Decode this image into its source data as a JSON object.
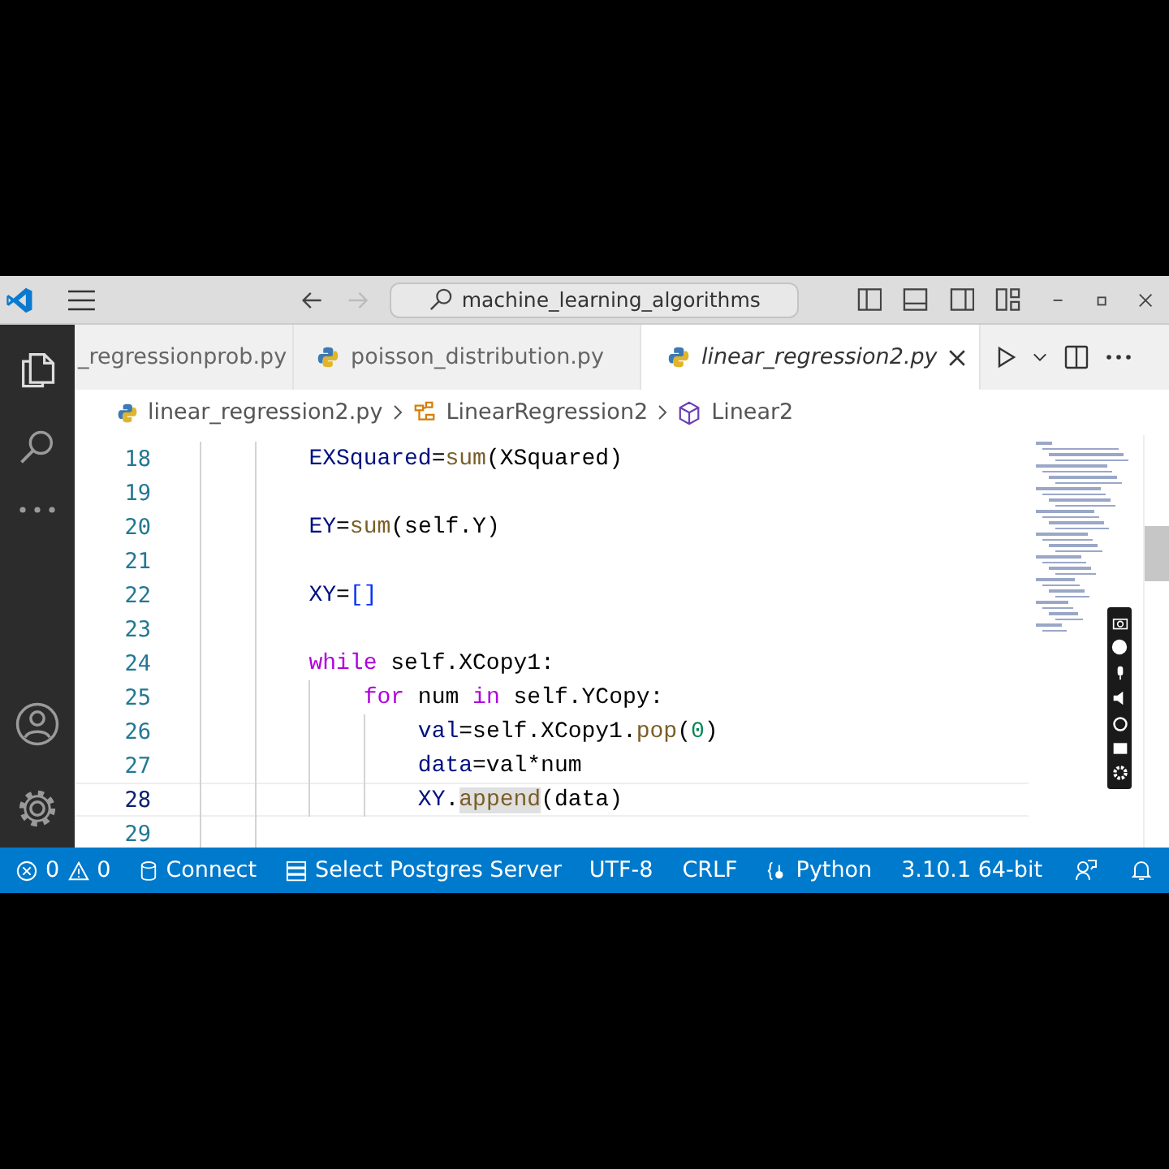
{
  "title_bar": {
    "search": {
      "value": "machine_learning_algorithms"
    },
    "forward_disabled": true
  },
  "activity_bar": {
    "items": [
      {
        "kind": "files",
        "selected": true
      },
      {
        "kind": "search",
        "selected": false
      },
      {
        "kind": "more",
        "selected": false
      }
    ],
    "bottom_items": [
      {
        "kind": "account"
      },
      {
        "kind": "settings"
      }
    ]
  },
  "tabs": [
    {
      "label": "_regressionprob.py",
      "icon": false,
      "selected": false,
      "preview": false
    },
    {
      "label": "poisson_distribution.py",
      "icon": true,
      "selected": false,
      "preview": false
    },
    {
      "label": "linear_regression2.py",
      "icon": true,
      "selected": true,
      "preview": true
    }
  ],
  "breadcrumbs": [
    {
      "kind": "file",
      "label": "linear_regression2.py"
    },
    {
      "kind": "class",
      "label": "LinearRegression2"
    },
    {
      "kind": "method",
      "label": "Linear2"
    }
  ],
  "editor": {
    "lines": [
      {
        "number": "18",
        "current": false,
        "tokens": [
          {
            "text": "        EXSquared",
            "kind": "var"
          },
          {
            "text": "=",
            "kind": "plain"
          },
          {
            "text": "sum",
            "kind": "fn"
          },
          {
            "text": "(XSquared)",
            "kind": "plain"
          }
        ]
      },
      {
        "number": "19",
        "current": false
      },
      {
        "number": "20",
        "current": false,
        "tokens": [
          {
            "text": "        EY",
            "kind": "var"
          },
          {
            "text": "=",
            "kind": "plain"
          },
          {
            "text": "sum",
            "kind": "fn"
          },
          {
            "text": "(self.Y)",
            "kind": "plain"
          }
        ]
      },
      {
        "number": "21",
        "current": false
      },
      {
        "number": "22",
        "current": false,
        "tokens": [
          {
            "text": "        XY",
            "kind": "var"
          },
          {
            "text": "=",
            "kind": "plain"
          },
          {
            "text": "[]",
            "kind": "bracket"
          }
        ]
      },
      {
        "number": "23",
        "current": false
      },
      {
        "number": "24",
        "current": false,
        "tokens": [
          {
            "text": "        while",
            "kind": "kw"
          },
          {
            "text": " self.XCopy1:",
            "kind": "plain"
          }
        ]
      },
      {
        "number": "25",
        "current": false,
        "tokens": [
          {
            "text": "            for",
            "kind": "kw"
          },
          {
            "text": " num ",
            "kind": "plain"
          },
          {
            "text": "in",
            "kind": "kw"
          },
          {
            "text": " self.YCopy:",
            "kind": "plain"
          }
        ]
      },
      {
        "number": "26",
        "current": false,
        "tokens": [
          {
            "text": "                val",
            "kind": "var"
          },
          {
            "text": "=self.XCopy1.",
            "kind": "plain"
          },
          {
            "text": "pop",
            "kind": "fn"
          },
          {
            "text": "(",
            "kind": "plain"
          },
          {
            "text": "0",
            "kind": "num"
          },
          {
            "text": ")",
            "kind": "plain"
          }
        ]
      },
      {
        "number": "27",
        "current": false,
        "tokens": [
          {
            "text": "                data",
            "kind": "var"
          },
          {
            "text": "=val*num",
            "kind": "plain"
          }
        ]
      },
      {
        "number": "28",
        "current": true,
        "tokens": [
          {
            "text": "                XY",
            "kind": "var"
          },
          {
            "text": ".",
            "kind": "plain"
          },
          {
            "text": "append",
            "kind": "fn",
            "highlighted": true
          },
          {
            "text": "(data)",
            "kind": "plain"
          }
        ]
      },
      {
        "number": "29",
        "current": false
      }
    ]
  },
  "status_bar": {
    "left": [
      {
        "kind": "problems",
        "errors": "0",
        "warnings": "0"
      },
      {
        "kind": "db",
        "label": "Connect"
      },
      {
        "kind": "server",
        "label": "Select Postgres Server"
      }
    ],
    "right": [
      {
        "kind": "text",
        "label": "UTF-8"
      },
      {
        "kind": "text",
        "label": "CRLF"
      },
      {
        "kind": "lang",
        "label": "Python"
      },
      {
        "kind": "text",
        "label": "3.10.1 64-bit"
      },
      {
        "kind": "feedback"
      },
      {
        "kind": "bell"
      }
    ]
  }
}
